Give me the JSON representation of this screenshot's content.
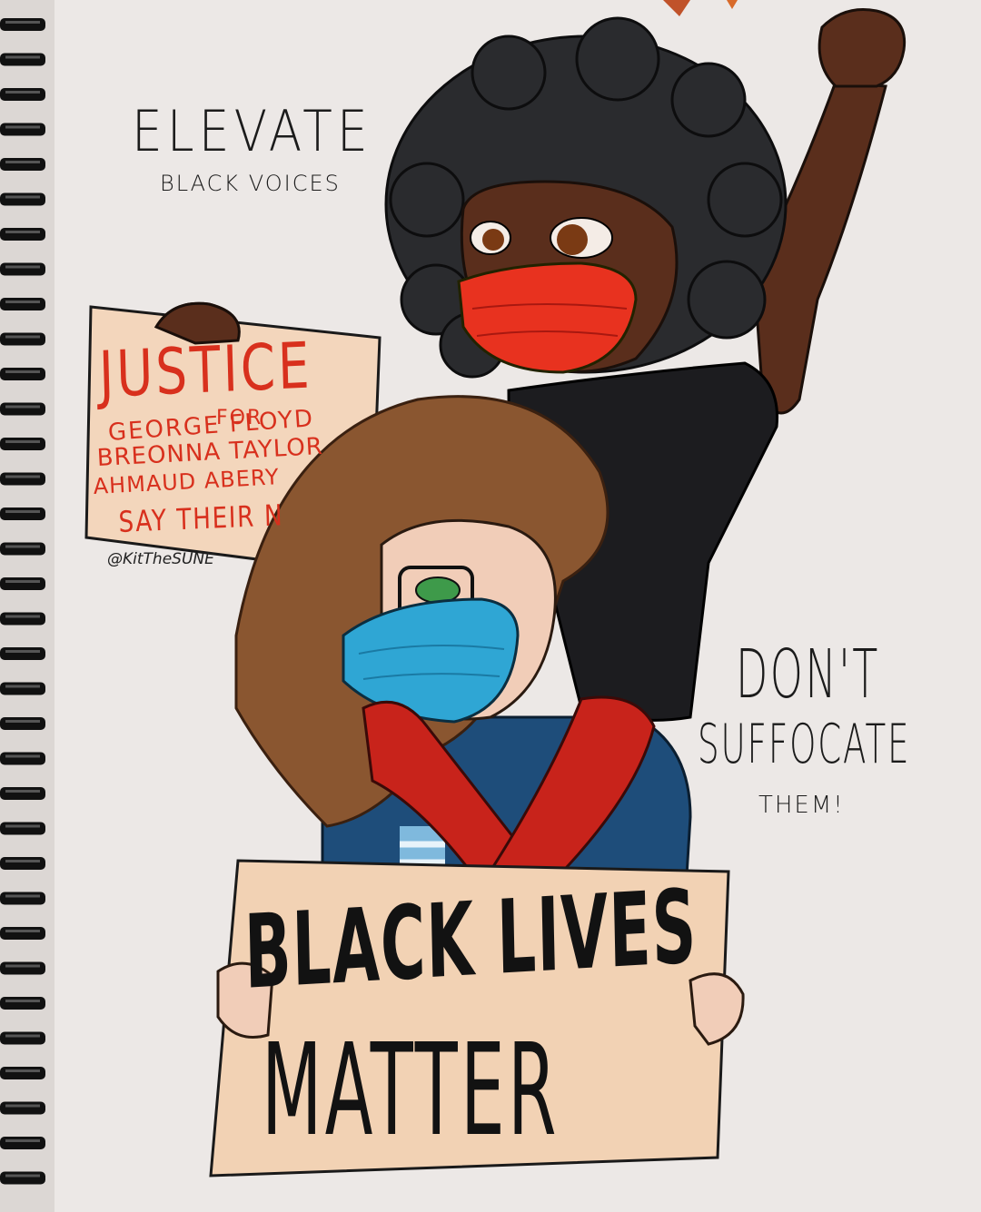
{
  "texts": {
    "elevate": "ELEVATE",
    "black_voices": "BLACK VOICES",
    "justice": "JUSTICE",
    "for": "FOR",
    "name1": "GEORGE FLOYD",
    "name2": "BREONNA TAYLOR",
    "name3": "AHMAUD ABERY",
    "say": "SAY THEIR N",
    "signature": "@KitTheSUNE",
    "dont": "DON'T",
    "suffocate": "SUFFOCATE",
    "them": "THEM!",
    "blm_line1": "BLACK LIVES",
    "blm_line2": "MATTER"
  },
  "colors": {
    "paper": "#ece8e6",
    "skin_dark": "#5a2e1c",
    "hair_dark": "#2a2b2e",
    "mask_red": "#e8321f",
    "shirt_black": "#1c1c1f",
    "hair_brown": "#8a5630",
    "mask_blue": "#2fa6d4",
    "jacket_blue": "#1e4d7a",
    "sleeve_red": "#c8231b",
    "sign_peach": "#f2d2b4",
    "spiral": "#111111"
  }
}
